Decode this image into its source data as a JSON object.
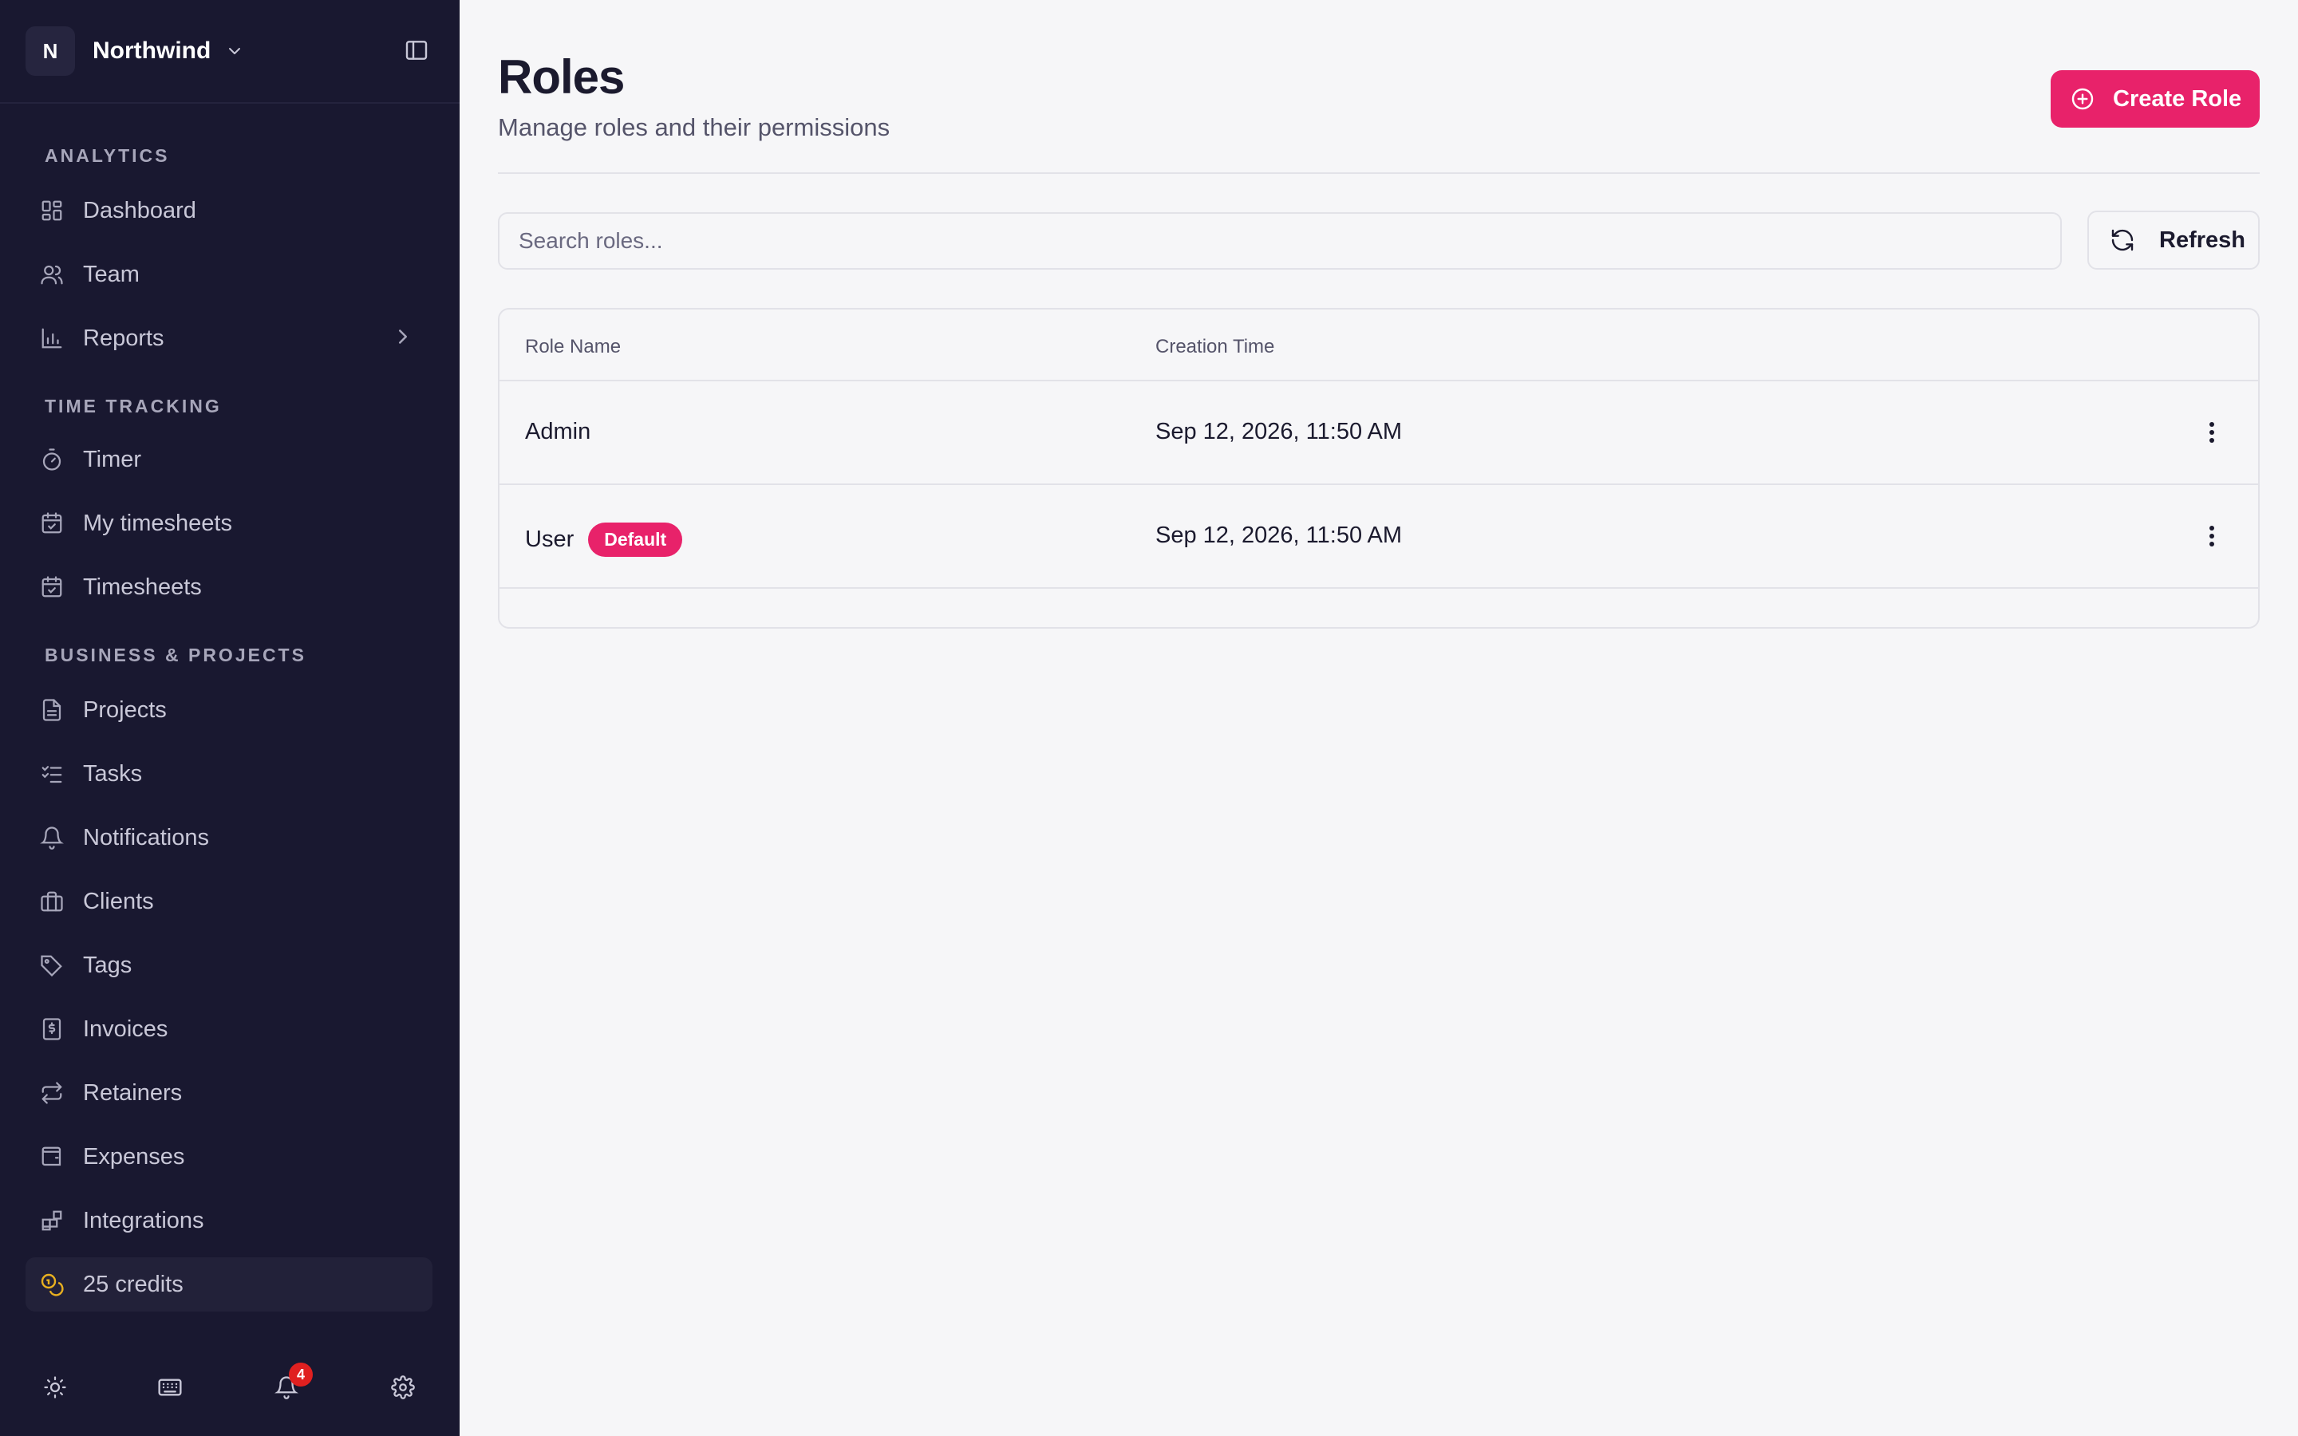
{
  "workspace": {
    "initial": "N",
    "name": "Northwind"
  },
  "sidebar": {
    "sections": [
      {
        "label": "ANALYTICS"
      },
      {
        "label": "TIME TRACKING"
      },
      {
        "label": "BUSINESS & PROJECTS"
      }
    ],
    "items": [
      {
        "label": "Dashboard",
        "icon": "dashboard-icon"
      },
      {
        "label": "Team",
        "icon": "users-icon"
      },
      {
        "label": "Reports",
        "icon": "bar-chart-icon"
      },
      {
        "label": "Timer",
        "icon": "stopwatch-icon"
      },
      {
        "label": "My timesheets",
        "icon": "calendar-check-icon"
      },
      {
        "label": "Timesheets",
        "icon": "calendar-check-icon"
      },
      {
        "label": "Projects",
        "icon": "file-icon"
      },
      {
        "label": "Tasks",
        "icon": "checklist-icon"
      },
      {
        "label": "Notifications",
        "icon": "bell-icon"
      },
      {
        "label": "Clients",
        "icon": "briefcase-icon"
      },
      {
        "label": "Tags",
        "icon": "tag-icon"
      },
      {
        "label": "Invoices",
        "icon": "invoice-icon"
      },
      {
        "label": "Retainers",
        "icon": "repeat-icon"
      },
      {
        "label": "Expenses",
        "icon": "wallet-icon"
      },
      {
        "label": "Integrations",
        "icon": "blocks-icon"
      }
    ],
    "credits": {
      "label": "25 credits",
      "icon": "coins-icon"
    },
    "footer": {
      "notification_count": "4"
    }
  },
  "page": {
    "title": "Roles",
    "subtitle": "Manage roles and their permissions",
    "create_button": "Create Role"
  },
  "search": {
    "placeholder": "Search roles..."
  },
  "refresh_button": "Refresh",
  "table": {
    "columns": [
      "Role Name",
      "Creation Time"
    ],
    "rows": [
      {
        "name": "Admin",
        "badge": "",
        "created": "Sep 12, 2026, 11:50 AM"
      },
      {
        "name": "User",
        "badge": "Default",
        "created": "Sep 12, 2026, 11:50 AM"
      }
    ]
  },
  "colors": {
    "sidebar_bg": "#191830",
    "accent": "#e8226a",
    "page_bg": "#f6f6f8",
    "notification_badge": "#e02020",
    "credits_icon": "#e8b020"
  }
}
